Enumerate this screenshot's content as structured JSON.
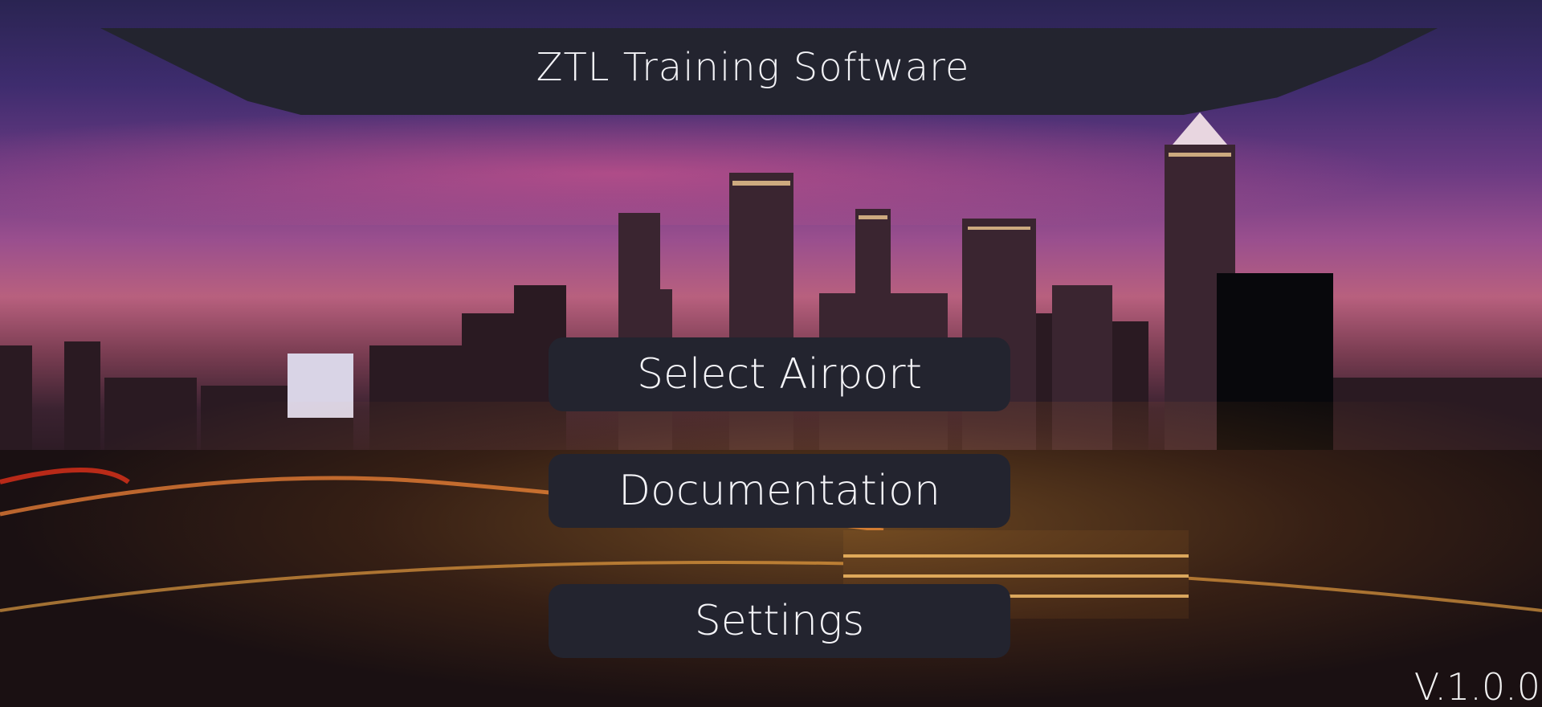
{
  "app": {
    "title": "ZTL Training Software",
    "version": "V.1.0.0"
  },
  "menu": {
    "select_airport_label": "Select Airport",
    "documentation_label": "Documentation",
    "settings_label": "Settings"
  },
  "background": {
    "subject": "city-skyline-at-dusk",
    "colors": {
      "sky_top": "#2a2452",
      "sky_mid": "#9a4f8e",
      "horizon": "#b8607e",
      "city_lights": "#ffb24a"
    }
  },
  "theme": {
    "panel_color": "#23242f",
    "text_color": "#f4f4f8"
  }
}
